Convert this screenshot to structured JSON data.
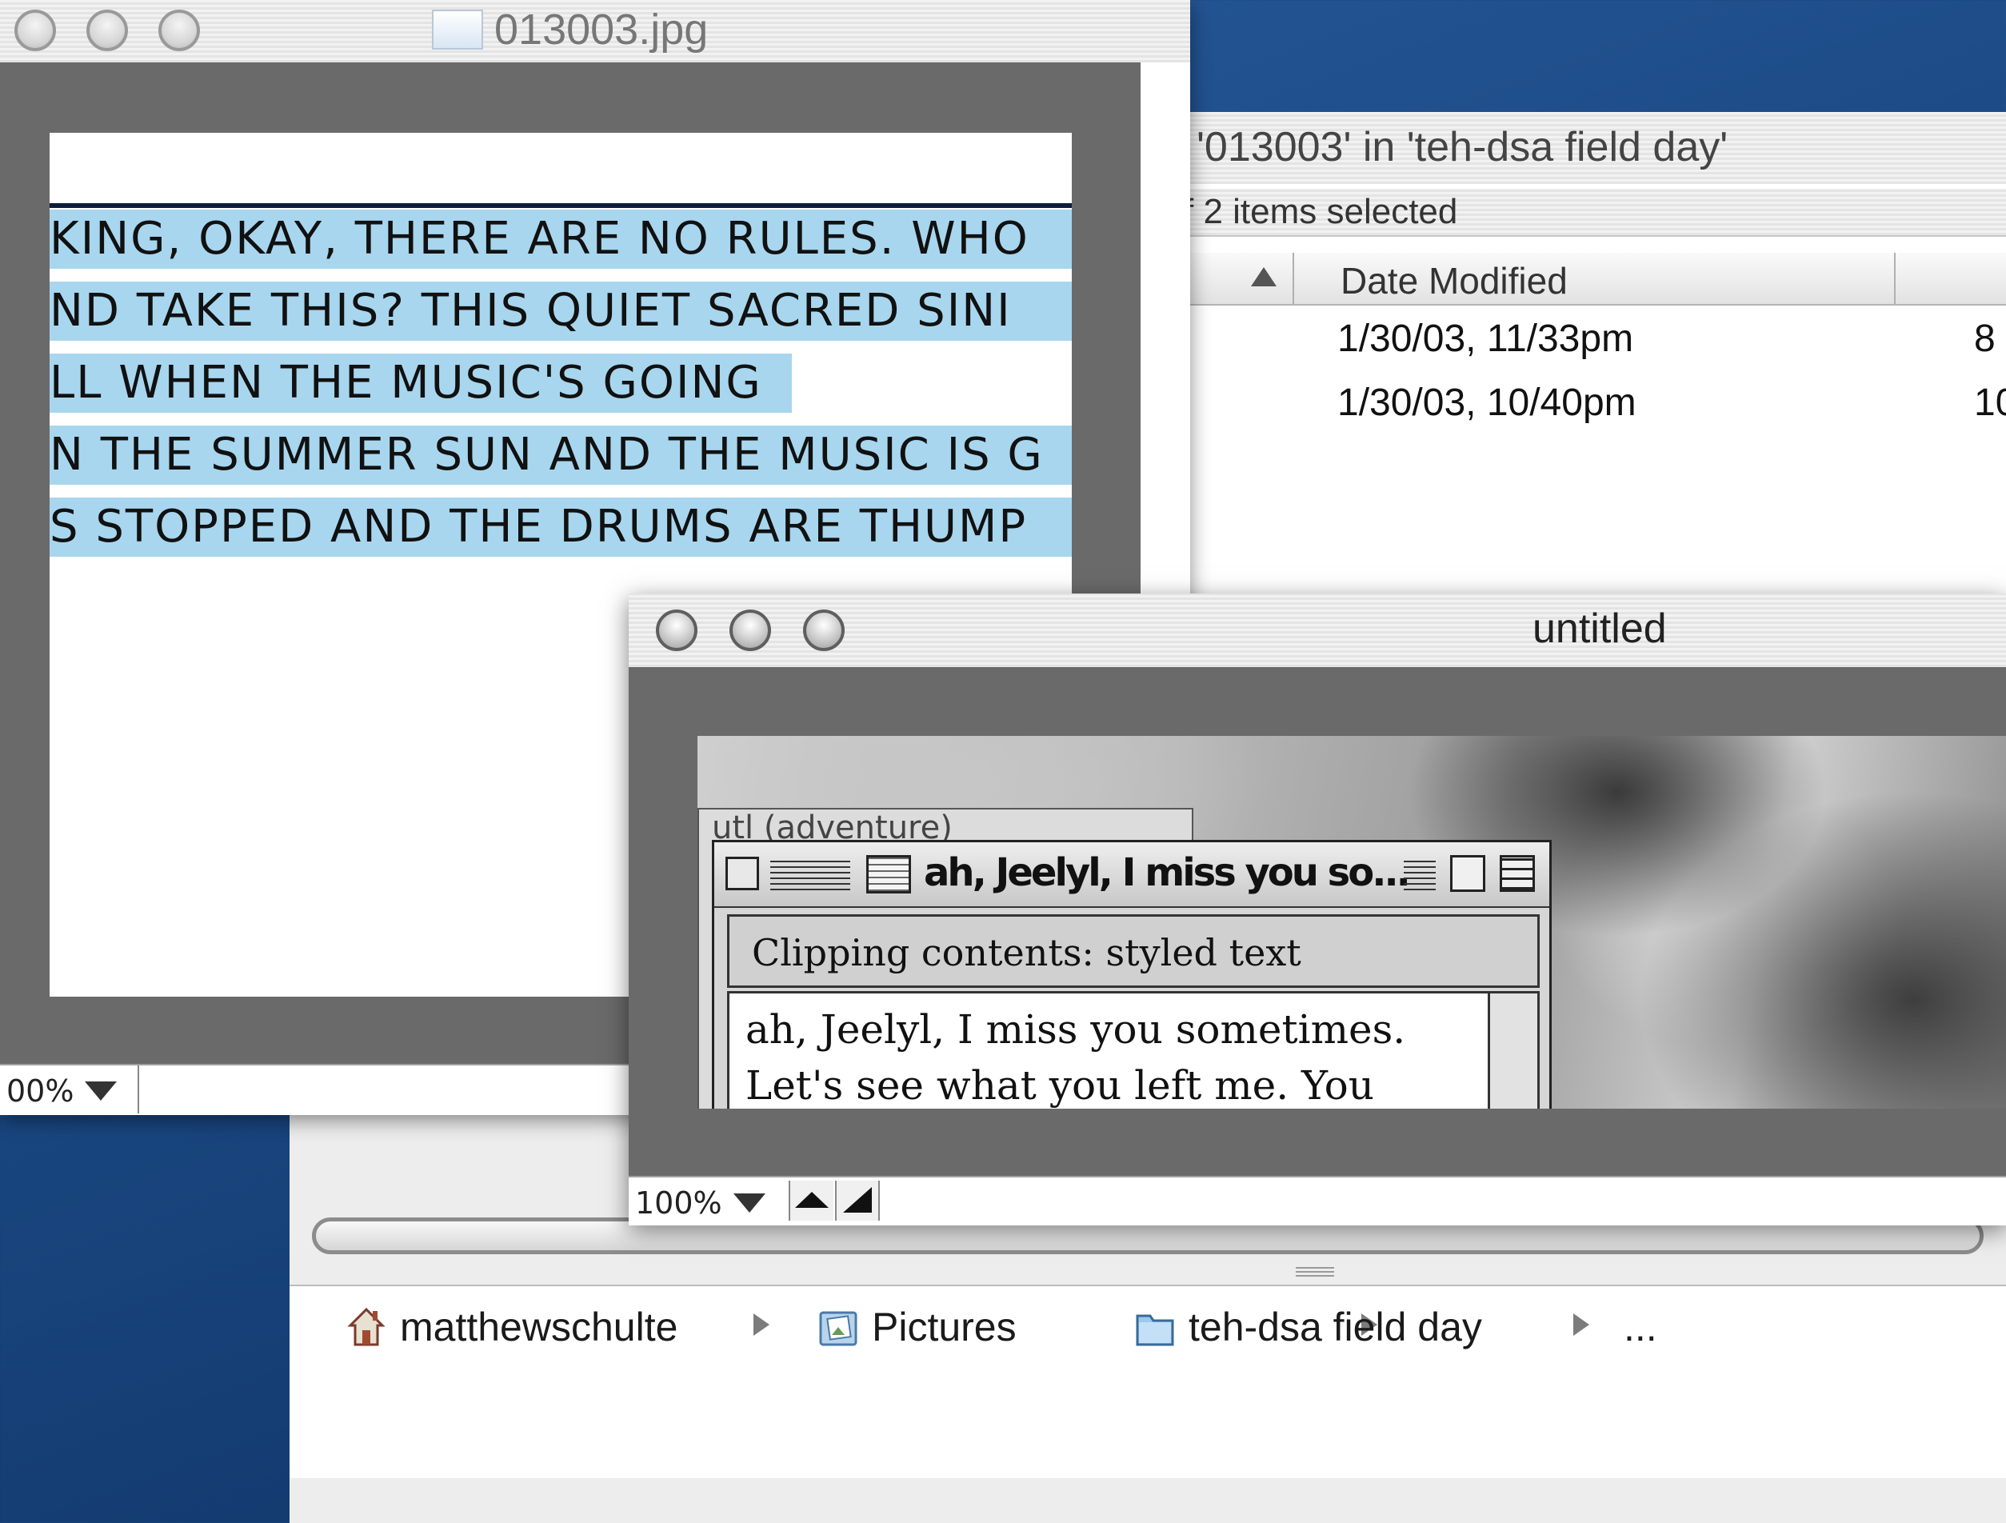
{
  "image_window": {
    "title": "013003.jpg",
    "text_lines": [
      "KING, OKAY, THERE ARE NO RULES. WHO",
      "ND TAKE THIS? THIS QUIET SACRED SINI",
      "LL WHEN THE MUSIC'S GOING",
      "N THE SUMMER SUN AND THE MUSIC IS G",
      "S STOPPED AND THE DRUMS ARE THUMP"
    ],
    "zoom": "00%"
  },
  "finder_list": {
    "title": "'013003' in 'teh-dsa field day'",
    "status": "f 2 items selected",
    "column_header": "Date Modified",
    "rows": [
      {
        "date": "1/30/03, 11/33pm",
        "size": "8"
      },
      {
        "date": "1/30/03, 10/40pm",
        "size": "10"
      }
    ]
  },
  "untitled_window": {
    "title": "untitled",
    "zoom": "100%",
    "back_window_title": "utl (adventure)",
    "clipping": {
      "title": "ah, Jeelyl, I miss you so...",
      "header": "Clipping contents: styled text",
      "lines": [
        "ah, Jeelyl, I miss you sometimes.",
        "Let's see what you left me. You"
      ]
    }
  },
  "path_bar": {
    "items": [
      "matthewschulte",
      "Pictures",
      "teh-dsa field day",
      "..."
    ]
  }
}
